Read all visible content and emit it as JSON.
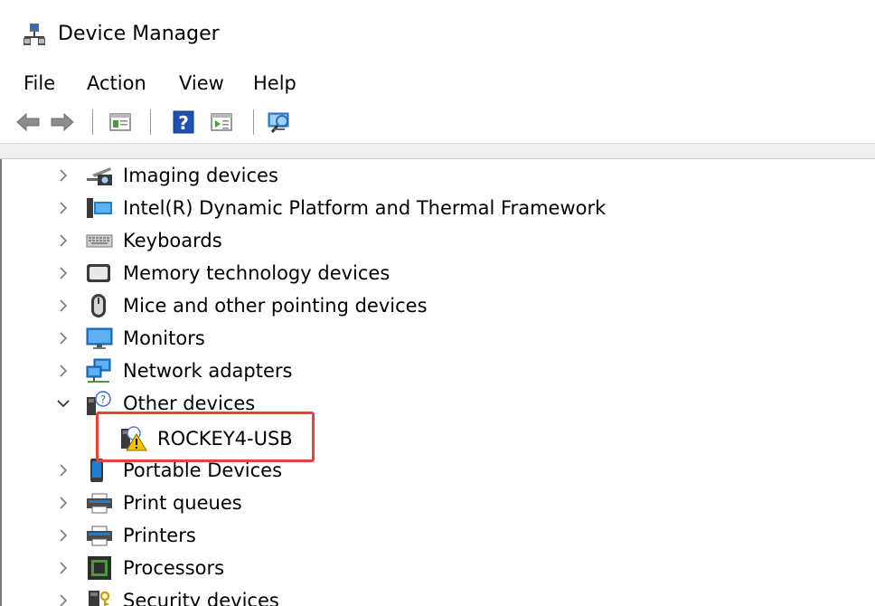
{
  "window": {
    "title": "Device Manager",
    "title_icon": "device-manager-icon"
  },
  "menu": {
    "items": [
      "File",
      "Action",
      "View",
      "Help"
    ]
  },
  "toolbar": {
    "buttons": [
      {
        "name": "back-arrow-icon"
      },
      {
        "name": "forward-arrow-icon"
      },
      {
        "name": "properties-icon"
      },
      {
        "name": "help-icon"
      },
      {
        "name": "update-driver-icon"
      },
      {
        "name": "scan-hardware-icon"
      }
    ]
  },
  "tree": {
    "nodes": [
      {
        "label": "Imaging devices",
        "icon": "camera-icon",
        "expanded": false
      },
      {
        "label": "Intel(R) Dynamic Platform and Thermal Framework",
        "icon": "intel-device-icon",
        "expanded": false
      },
      {
        "label": "Keyboards",
        "icon": "keyboard-icon",
        "expanded": false
      },
      {
        "label": "Memory technology devices",
        "icon": "memory-card-icon",
        "expanded": false
      },
      {
        "label": "Mice and other pointing devices",
        "icon": "mouse-icon",
        "expanded": false
      },
      {
        "label": "Monitors",
        "icon": "monitor-icon",
        "expanded": false
      },
      {
        "label": "Network adapters",
        "icon": "network-adapter-icon",
        "expanded": false
      },
      {
        "label": "Other devices",
        "icon": "unknown-device-icon",
        "expanded": true,
        "children": [
          {
            "label": "ROCKEY4-USB",
            "icon": "warning-device-icon",
            "status": "warning"
          }
        ]
      },
      {
        "label": "Portable Devices",
        "icon": "portable-device-icon",
        "expanded": false
      },
      {
        "label": "Print queues",
        "icon": "printer-icon",
        "expanded": false
      },
      {
        "label": "Printers",
        "icon": "printer-icon",
        "expanded": false
      },
      {
        "label": "Processors",
        "icon": "processor-icon",
        "expanded": false
      },
      {
        "label": "Security devices",
        "icon": "security-device-icon",
        "expanded": false
      }
    ]
  },
  "colors": {
    "highlight": "#e8403a",
    "icon_blue": "#1a7fd4",
    "warning_yellow": "#f5c400"
  }
}
